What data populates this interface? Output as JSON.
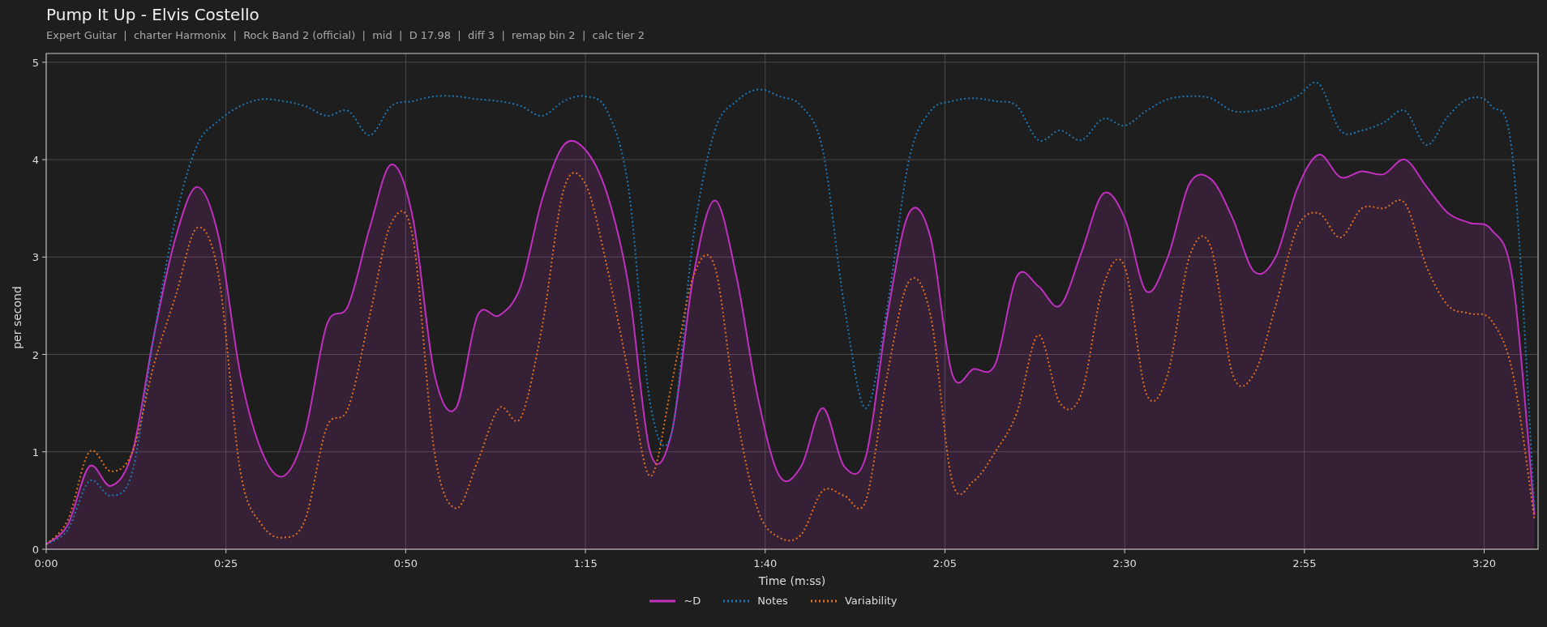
{
  "title": "Pump It Up - Elvis Costello",
  "subtitle": "Expert Guitar  |  charter Harmonix  |  Rock Band 2 (official)  |  mid  |  D 17.98  |  diff 3  |  remap bin 2  |  calc tier 2",
  "chart": {
    "chart_data": {
      "type": "line",
      "xlabel": "Time (m:ss)",
      "ylabel": "per second",
      "x": [
        0,
        3,
        6,
        9,
        12,
        15,
        18,
        21,
        24,
        27,
        30,
        33,
        36,
        39,
        42,
        45,
        48,
        51,
        54,
        57,
        60,
        63,
        66,
        69,
        72,
        75,
        78,
        81,
        84,
        87,
        90,
        93,
        96,
        99,
        102,
        105,
        108,
        111,
        114,
        117,
        120,
        123,
        126,
        129,
        132,
        135,
        138,
        141,
        144,
        147,
        150,
        153,
        156,
        159,
        162,
        165,
        168,
        171,
        174,
        177,
        180,
        183,
        186,
        189,
        192,
        195,
        198,
        201,
        204,
        207
      ],
      "xlim": [
        0,
        207.5
      ],
      "ylim": [
        0,
        5.09
      ],
      "xticks": [
        {
          "value": 0,
          "label": "0:00"
        },
        {
          "value": 25,
          "label": "0:25"
        },
        {
          "value": 50,
          "label": "0:50"
        },
        {
          "value": 75,
          "label": "1:15"
        },
        {
          "value": 100,
          "label": "1:40"
        },
        {
          "value": 125,
          "label": "2:05"
        },
        {
          "value": 150,
          "label": "2:30"
        },
        {
          "value": 175,
          "label": "2:55"
        },
        {
          "value": 200,
          "label": "3:20"
        }
      ],
      "yticks": [
        0,
        1,
        2,
        3,
        4,
        5
      ],
      "grid": true,
      "series": [
        {
          "name": "~D",
          "color": "#c030c0",
          "line_style": "solid",
          "type": "area",
          "values": [
            0.05,
            0.25,
            0.85,
            0.65,
            1.0,
            2.2,
            3.2,
            3.72,
            3.2,
            1.8,
            1.0,
            0.75,
            1.2,
            2.3,
            2.5,
            3.3,
            3.95,
            3.4,
            1.8,
            1.45,
            2.4,
            2.4,
            2.7,
            3.6,
            4.15,
            4.1,
            3.65,
            2.7,
            1.0,
            1.2,
            2.8,
            3.58,
            2.8,
            1.55,
            0.75,
            0.85,
            1.45,
            0.85,
            0.95,
            2.4,
            3.45,
            3.2,
            1.8,
            1.85,
            1.9,
            2.8,
            2.7,
            2.5,
            3.05,
            3.65,
            3.4,
            2.65,
            3.0,
            3.75,
            3.8,
            3.4,
            2.85,
            3.0,
            3.7,
            4.05,
            3.82,
            3.88,
            3.85,
            4.0,
            3.72,
            3.45,
            3.35,
            3.28,
            2.75,
            0.35
          ]
        },
        {
          "name": "Notes",
          "color": "#1f77b4",
          "line_style": "dotted",
          "type": "line",
          "values": [
            0.05,
            0.2,
            0.7,
            0.55,
            0.8,
            2.2,
            3.4,
            4.15,
            4.4,
            4.55,
            4.62,
            4.6,
            4.55,
            4.45,
            4.5,
            4.25,
            4.55,
            4.6,
            4.65,
            4.65,
            4.62,
            4.6,
            4.55,
            4.45,
            4.6,
            4.65,
            4.5,
            3.7,
            1.5,
            1.2,
            3.2,
            4.3,
            4.6,
            4.72,
            4.65,
            4.55,
            4.1,
            2.5,
            1.45,
            2.5,
            4.0,
            4.5,
            4.6,
            4.63,
            4.6,
            4.55,
            4.2,
            4.3,
            4.2,
            4.42,
            4.35,
            4.5,
            4.62,
            4.65,
            4.63,
            4.5,
            4.5,
            4.55,
            4.65,
            4.78,
            4.3,
            4.3,
            4.38,
            4.5,
            4.15,
            4.45,
            4.63,
            4.55,
            4.0,
            0.4
          ]
        },
        {
          "name": "Variability",
          "color": "#e0701e",
          "line_style": "dotted",
          "type": "line",
          "values": [
            0.05,
            0.3,
            1.0,
            0.8,
            1.0,
            1.9,
            2.6,
            3.3,
            2.8,
            0.8,
            0.25,
            0.12,
            0.3,
            1.25,
            1.45,
            2.4,
            3.35,
            3.2,
            1.0,
            0.42,
            0.9,
            1.45,
            1.35,
            2.3,
            3.7,
            3.75,
            2.9,
            1.8,
            0.75,
            1.7,
            2.8,
            2.9,
            1.4,
            0.4,
            0.12,
            0.15,
            0.6,
            0.55,
            0.5,
            1.8,
            2.75,
            2.4,
            0.7,
            0.7,
            1.0,
            1.4,
            2.2,
            1.5,
            1.6,
            2.7,
            2.9,
            1.6,
            1.8,
            3.0,
            3.1,
            1.8,
            1.8,
            2.5,
            3.3,
            3.45,
            3.2,
            3.5,
            3.5,
            3.55,
            2.9,
            2.5,
            2.42,
            2.35,
            1.8,
            0.3
          ]
        }
      ]
    }
  }
}
